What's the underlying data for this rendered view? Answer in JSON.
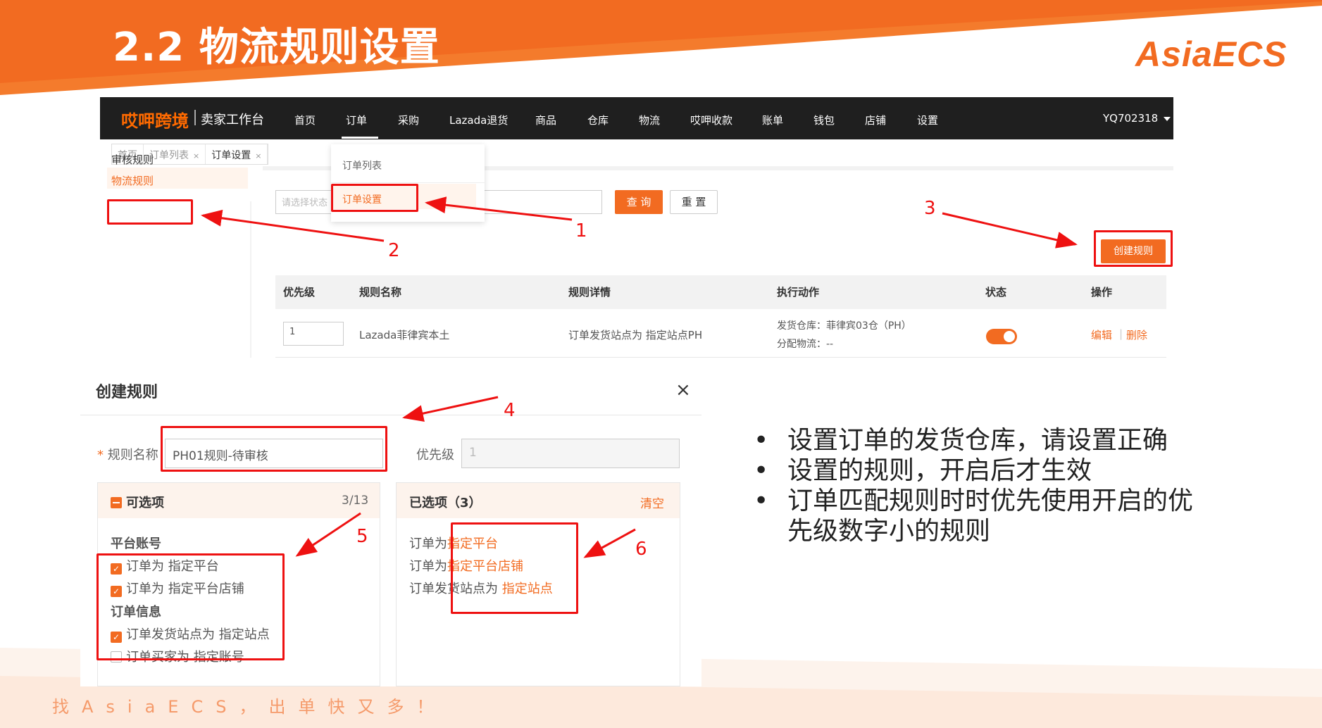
{
  "slide": {
    "title": "2.2 物流规则设置",
    "logo": "AsiaECS",
    "footer": "找AsiaECS，出单快又多！"
  },
  "colors": {
    "accent": "#f26b21",
    "annotation": "#ee1111",
    "nav_bg": "#1f1f1f"
  },
  "app": {
    "brand": "哎呷跨境",
    "brand_sub": "卖家工作台",
    "nav": [
      "首页",
      "订单",
      "采购",
      "Lazada退货",
      "商品",
      "仓库",
      "物流",
      "哎呷收款",
      "账单",
      "钱包",
      "店铺",
      "设置"
    ],
    "active_nav": "订单",
    "user": "YQ702318",
    "breadcrumbs": [
      {
        "label": "首页",
        "closable": false
      },
      {
        "label": "订单列表",
        "closable": true
      },
      {
        "label": "订单设置",
        "closable": true
      }
    ],
    "sidebar": [
      "审核规则",
      "物流规则"
    ],
    "dropdown": [
      "订单列表",
      "订单设置"
    ],
    "filter": {
      "placeholder": "请选择状态",
      "query_label": "查 询",
      "reset_label": "重 置"
    },
    "create_label": "创建规则",
    "table": {
      "headers": [
        "优先级",
        "规则名称",
        "规则详情",
        "执行动作",
        "状态",
        "操作"
      ],
      "row": {
        "priority": "1",
        "name": "Lazada菲律宾本土",
        "detail": "订单发货站点为 指定站点PH",
        "action_line1": "发货仓库：菲律宾03仓（PH）",
        "action_line2": "分配物流：--",
        "status_on": true,
        "edit": "编辑",
        "sep": "|",
        "delete": "删除"
      }
    }
  },
  "dialog": {
    "title": "创建规则",
    "close": "×",
    "name_label": "规则名称",
    "required_mark": "*",
    "name_value": "PH01规则-待审核",
    "priority_label": "优先级",
    "priority_value": "1",
    "optional": {
      "title": "可选项",
      "count": "3/13",
      "groups": [
        {
          "title": "平台账号"
        },
        {
          "title": "订单信息"
        }
      ],
      "items": [
        {
          "prefix": "订单为 ",
          "value": "指定平台",
          "checked": true
        },
        {
          "prefix": "订单为 ",
          "value": "指定平台店铺",
          "checked": true
        },
        {
          "prefix": "订单发货站点为 ",
          "value": "指定站点",
          "checked": true
        },
        {
          "prefix": "订单买家为 ",
          "value": "指定账号",
          "checked": false
        }
      ]
    },
    "selected": {
      "title": "已选项（3）",
      "clear": "清空",
      "items": [
        {
          "prefix": "订单为",
          "value": "指定平台"
        },
        {
          "prefix": "订单为",
          "value": "指定平台店铺"
        },
        {
          "prefix": "订单发货站点为 ",
          "value": "指定站点"
        }
      ]
    }
  },
  "annotations": [
    "1",
    "2",
    "3",
    "4",
    "5",
    "6"
  ],
  "bullets": [
    "设置订单的发货仓库，请设置正确",
    "设置的规则，开启后才生效",
    "订单匹配规则时时优先使用开启的优先级数字小的规则"
  ],
  "bullet_symbol": "•"
}
